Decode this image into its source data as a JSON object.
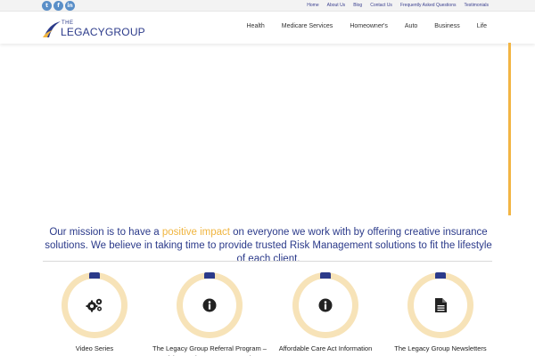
{
  "social": [
    {
      "icon": "twitter-icon",
      "glyph": "t"
    },
    {
      "icon": "facebook-icon",
      "glyph": "f"
    },
    {
      "icon": "linkedin-icon",
      "glyph": "in"
    }
  ],
  "top_links": [
    "Home",
    "About Us",
    "Blog",
    "Contact Us",
    "Frequently Asked Questions",
    "Testimonials"
  ],
  "logo": {
    "small": "THE",
    "name": "LEGACYGROUP"
  },
  "nav": [
    "Health",
    "Medicare Services",
    "Homeowner's",
    "Auto",
    "Business",
    "Life"
  ],
  "mission": {
    "part1": "Our mission is to have a ",
    "highlight": "positive impact",
    "part2": " on everyone we work with by offering creative insurance solutions. We believe in taking time to provide trusted Risk Management solutions to fit the lifestyle of each client."
  },
  "features": [
    {
      "icon": "gears-icon",
      "label": "Video Series"
    },
    {
      "icon": "info-icon",
      "label": "The Legacy Group Referral Program – Giving Back To Our Community"
    },
    {
      "icon": "info-icon",
      "label": "Affordable Care Act Information"
    },
    {
      "icon": "document-icon",
      "label": "The Legacy Group Newsletters"
    }
  ],
  "colors": {
    "brand_blue": "#2b3a8a",
    "accent_gold": "#f0b53f",
    "ring_light": "#f7e3b8",
    "social_blue": "#5a8fc8"
  }
}
